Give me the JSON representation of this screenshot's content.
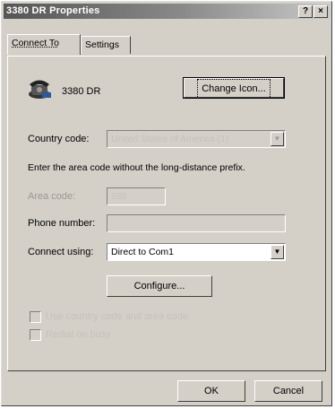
{
  "window": {
    "title": "3380 DR Properties",
    "help_label": "?",
    "close_label": "×"
  },
  "tabs": [
    {
      "label": "Connect To"
    },
    {
      "label": "Settings"
    }
  ],
  "connection": {
    "icon": "phone-icon",
    "name": "3380 DR",
    "change_icon_label": "Change Icon..."
  },
  "country": {
    "label": "Country code:",
    "value": "United States of America (1)"
  },
  "instruction": "Enter the area code without the long-distance prefix.",
  "area_code": {
    "label": "Area code:",
    "value": "555"
  },
  "phone": {
    "label": "Phone number:",
    "value": ""
  },
  "connect_using": {
    "label": "Connect using:",
    "value": "Direct to Com1"
  },
  "configure_label": "Configure...",
  "checkboxes": [
    {
      "label": "Use country code and area code",
      "checked": false
    },
    {
      "label": "Redial on busy",
      "checked": false
    }
  ],
  "footer": {
    "ok_label": "OK",
    "cancel_label": "Cancel"
  },
  "colors": {
    "face": "#d4d0c8",
    "titlebar": "#555555"
  }
}
